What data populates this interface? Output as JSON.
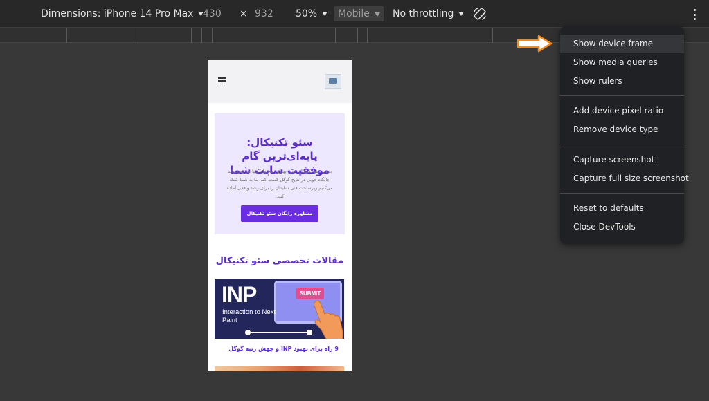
{
  "toolbar": {
    "dimensions_label": "Dimensions: iPhone 14 Pro Max",
    "width_value": "430",
    "times_symbol": "×",
    "height_value": "932",
    "zoom_value": "50%",
    "device_type": "Mobile",
    "throttling_value": "No throttling"
  },
  "site": {
    "hero": {
      "title": "سئو تکنیکال: پایه‌ای‌ترین گام موفقیت سایت شما",
      "description": "بدون سئو تکنیکال، حتی بهترین محتوای دنیا هم نمی‌تواند جایگاه خوبی در نتایج گوگل کسب کند. ما به شما کمک می‌کنیم زیرساخت فنی سایتتان را برای رشد واقعی آماده کنید.",
      "cta_label": "مشاوره رایگان سئو تکنیکال"
    },
    "section_title": "مقالات تخصصی سئو تکنیکال",
    "article_card": {
      "image_title": "INP",
      "image_subtitle": "Interaction to Next Paint",
      "image_button": "SUBMIT",
      "caption": "9 راه برای بهبود INP و جهش رتبه گوگل"
    }
  },
  "menu": {
    "items": [
      {
        "label": "Show device frame",
        "highlighted": true
      },
      {
        "label": "Show media queries"
      },
      {
        "label": "Show rulers"
      },
      {
        "label": "Add device pixel ratio"
      },
      {
        "label": "Remove device type"
      },
      {
        "label": "Capture screenshot"
      },
      {
        "label": "Capture full size screenshot"
      },
      {
        "label": "Reset to defaults"
      },
      {
        "label": "Close DevTools"
      }
    ]
  },
  "colors": {
    "accent_purple": "#5b2bd6",
    "button_purple": "#6a2ee0",
    "hero_background": "#ede8fd",
    "pointer_orange": "#f08a1c",
    "devtools_background": "#383838"
  },
  "icons": {
    "rotate": "rotate-icon",
    "more": "more-vert-icon",
    "menu": "hamburger-icon"
  }
}
